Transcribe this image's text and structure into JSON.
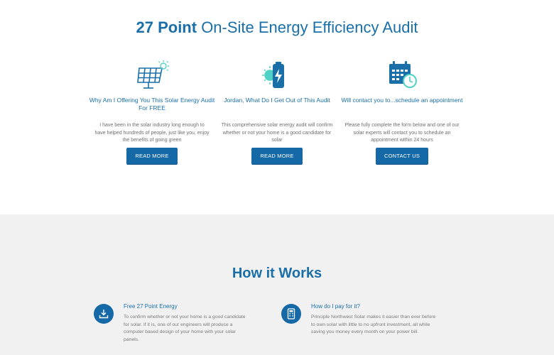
{
  "hero": {
    "title_bold": "27 Point",
    "title_rest": " On-Site Energy Efficiency Audit"
  },
  "columns": [
    {
      "icon": "solar-panel-icon",
      "title": "Why Am I Offering You This Solar Energy Audit For FREE",
      "text": "I have been in the solar industry long enough to have helped hundreds of people, just like you, enjoy the benefits of going green",
      "button": "READ MORE"
    },
    {
      "icon": "battery-sun-icon",
      "title": "Jordan, What Do I Get Out of This Audit",
      "text": "This comprehensive solar energy audit will confirm whether or not your home is a good candidate for solar",
      "button": "READ MORE"
    },
    {
      "icon": "calendar-clock-icon",
      "title": "Will contact you to...schedule an appointment",
      "text": "Please fully complete the form below and one of our solar experts will contact you to schedule an appointment within 24 hours",
      "button": "CONTACT US"
    }
  ],
  "how": {
    "title_rest": "How it ",
    "title_bold": "Works"
  },
  "features": [
    {
      "icon": "download-icon",
      "title": "Free 27 Point Energy",
      "text": "To confirm whether or not your home is a good candidate for solar. If it is, one of our engineers will produce a computer based design of your home with your solar panels."
    },
    {
      "icon": "calculator-icon",
      "title": "How do I pay for it?",
      "text": "Principle Northwest Solar makes it easier than ever before to own solar with little to no upfront investment, all while saving you money every month on your power bill."
    }
  ],
  "colors": {
    "accent": "#1a6fa8",
    "button": "#1569a6",
    "icon_highlight": "#4fd1c5",
    "section_bg": "#f1f1f1"
  }
}
